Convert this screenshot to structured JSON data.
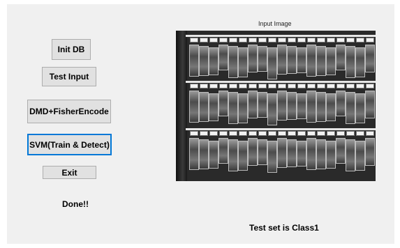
{
  "buttons": {
    "init_db": "Init DB",
    "test_input": "Test Input",
    "dmd_fisher": "DMD+FisherEncode",
    "svm": "SVM(Train & Detect)",
    "exit": "Exit"
  },
  "status": {
    "done": "Done!!",
    "result": "Test set is Class1"
  },
  "axes": {
    "title": "Input Image"
  },
  "colors": {
    "window_bg": "#f0f0f0",
    "button_bg": "#e1e1e1",
    "focus_border": "#0078d7"
  }
}
